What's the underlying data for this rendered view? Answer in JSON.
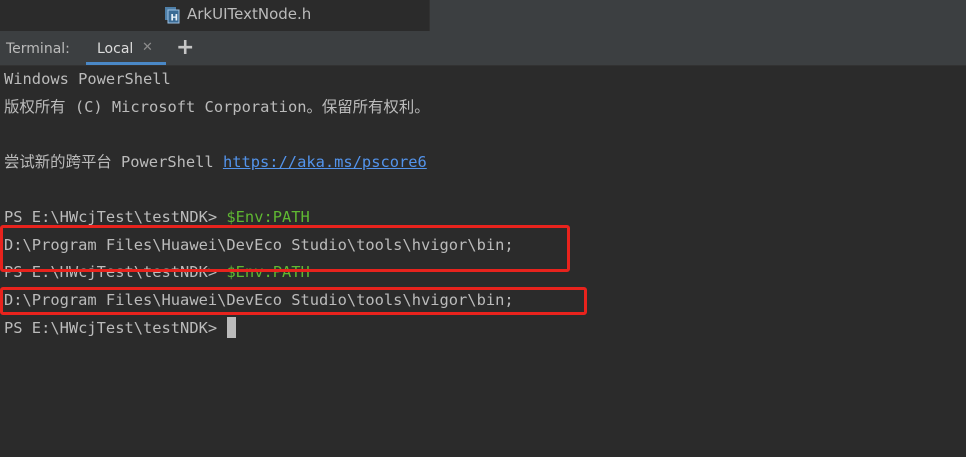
{
  "editor": {
    "file_tab_label": "ArkUITextNode.h",
    "file_icon": "header-file-icon"
  },
  "terminal": {
    "title": "Terminal:",
    "tab_label": "Local",
    "tab_close_icon": "close-icon",
    "add_tab_icon": "plus-icon"
  },
  "lines": {
    "l1": "Windows PowerShell",
    "l2": "版权所有 (C) Microsoft Corporation。保留所有权利。",
    "l4_prefix": "尝试新的跨平台 PowerShell ",
    "l4_link": "https://aka.ms/pscore6",
    "l6_prompt": "PS E:\\HWcjTest\\testNDK> ",
    "l6_cmd": "$Env:PATH",
    "l7": "D:\\Program Files\\Huawei\\DevEco Studio\\tools\\hvigor\\bin;",
    "l8_prompt": "PS E:\\HWcjTest\\testNDK> ",
    "l8_cmd": "$Env:PATH",
    "l9": "D:\\Program Files\\Huawei\\DevEco Studio\\tools\\hvigor\\bin;",
    "l10_prompt": "PS E:\\HWcjTest\\testNDK>"
  },
  "colors": {
    "background": "#2b2b2b",
    "text": "#bbbbbb",
    "command": "#5fb832",
    "link": "#5394ec",
    "highlight": "#e8231d",
    "active_tab_underline": "#4a88c7"
  }
}
